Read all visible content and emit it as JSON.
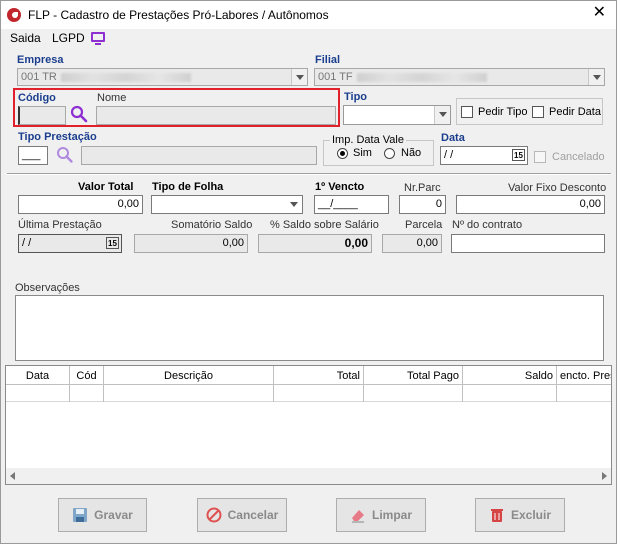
{
  "window": {
    "title": "FLP - Cadastro de Prestações Pró-Labores / Autônomos",
    "close": "✕"
  },
  "menu": {
    "saida": "Saida",
    "lgpd": "LGPD"
  },
  "empresa": {
    "label": "Empresa",
    "value": "001 TR"
  },
  "filial": {
    "label": "Filial",
    "value": "001 TF"
  },
  "codigo": {
    "label": "Código",
    "value": ""
  },
  "nome": {
    "label": "Nome",
    "value": ""
  },
  "tipo": {
    "label": "Tipo",
    "value": ""
  },
  "pedir_tipo": {
    "label": "Pedir Tipo"
  },
  "pedir_data": {
    "label": "Pedir Data"
  },
  "tipo_prestacao": {
    "label": "Tipo Prestação",
    "value": "___"
  },
  "imp_data_vale": {
    "label": "Imp. Data Vale",
    "sim": "Sim",
    "nao": "Não",
    "selected": "Sim"
  },
  "data": {
    "label": "Data",
    "value": "/ /"
  },
  "cancelado": {
    "label": "Cancelado"
  },
  "valor_total": {
    "label": "Valor Total",
    "value": "0,00"
  },
  "tipo_folha": {
    "label": "Tipo de Folha",
    "value": ""
  },
  "primeiro_vencto": {
    "label": "1º Vencto",
    "value": "__/____"
  },
  "nr_parc": {
    "label": "Nr.Parc",
    "value": "0"
  },
  "valor_fixo_desconto": {
    "label": "Valor Fixo Desconto",
    "value": "0,00"
  },
  "ultima_prestacao": {
    "label": "Última Prestação",
    "value": "/ /"
  },
  "somatorio_saldo": {
    "label": "Somatório Saldo",
    "value": "0,00"
  },
  "pct_saldo_salario": {
    "label": "% Saldo sobre Salário",
    "value": "0,00"
  },
  "parcela": {
    "label": "Parcela",
    "value": "0,00"
  },
  "nr_contrato": {
    "label": "Nº do contrato",
    "value": ""
  },
  "observacoes": {
    "label": "Observações",
    "value": ""
  },
  "grid": {
    "columns": [
      "Data",
      "Cód",
      "Descrição",
      "Total",
      "Total Pago",
      "Saldo",
      "encto. Pres"
    ]
  },
  "buttons": {
    "gravar": "Gravar",
    "cancelar": "Cancelar",
    "limpar": "Limpar",
    "excluir": "Excluir"
  },
  "calendar_icon_text": "15",
  "colors": {
    "accent": "#1b3e8f",
    "highlight_border": "#e0202b",
    "search_icon": "#8e2fd1"
  }
}
